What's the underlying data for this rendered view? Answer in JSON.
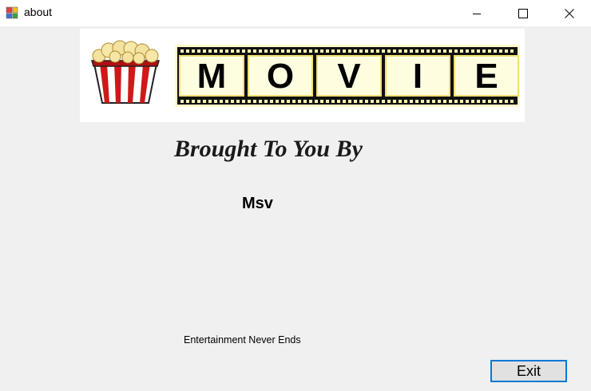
{
  "window": {
    "title": "about",
    "controls": {
      "minimize": "minimize-icon",
      "maximize": "maximize-icon",
      "close": "close-icon"
    }
  },
  "banner": {
    "letters": [
      "M",
      "O",
      "V",
      "I",
      "E"
    ],
    "icon": "popcorn-icon"
  },
  "content": {
    "heading": "Brought To You By",
    "author": "Msv",
    "tagline": "Entertainment Never Ends"
  },
  "buttons": {
    "exit": "Exit"
  },
  "colors": {
    "accent": "#0078d7",
    "background": "#f0f0f0",
    "popcorn_red": "#d01818"
  }
}
